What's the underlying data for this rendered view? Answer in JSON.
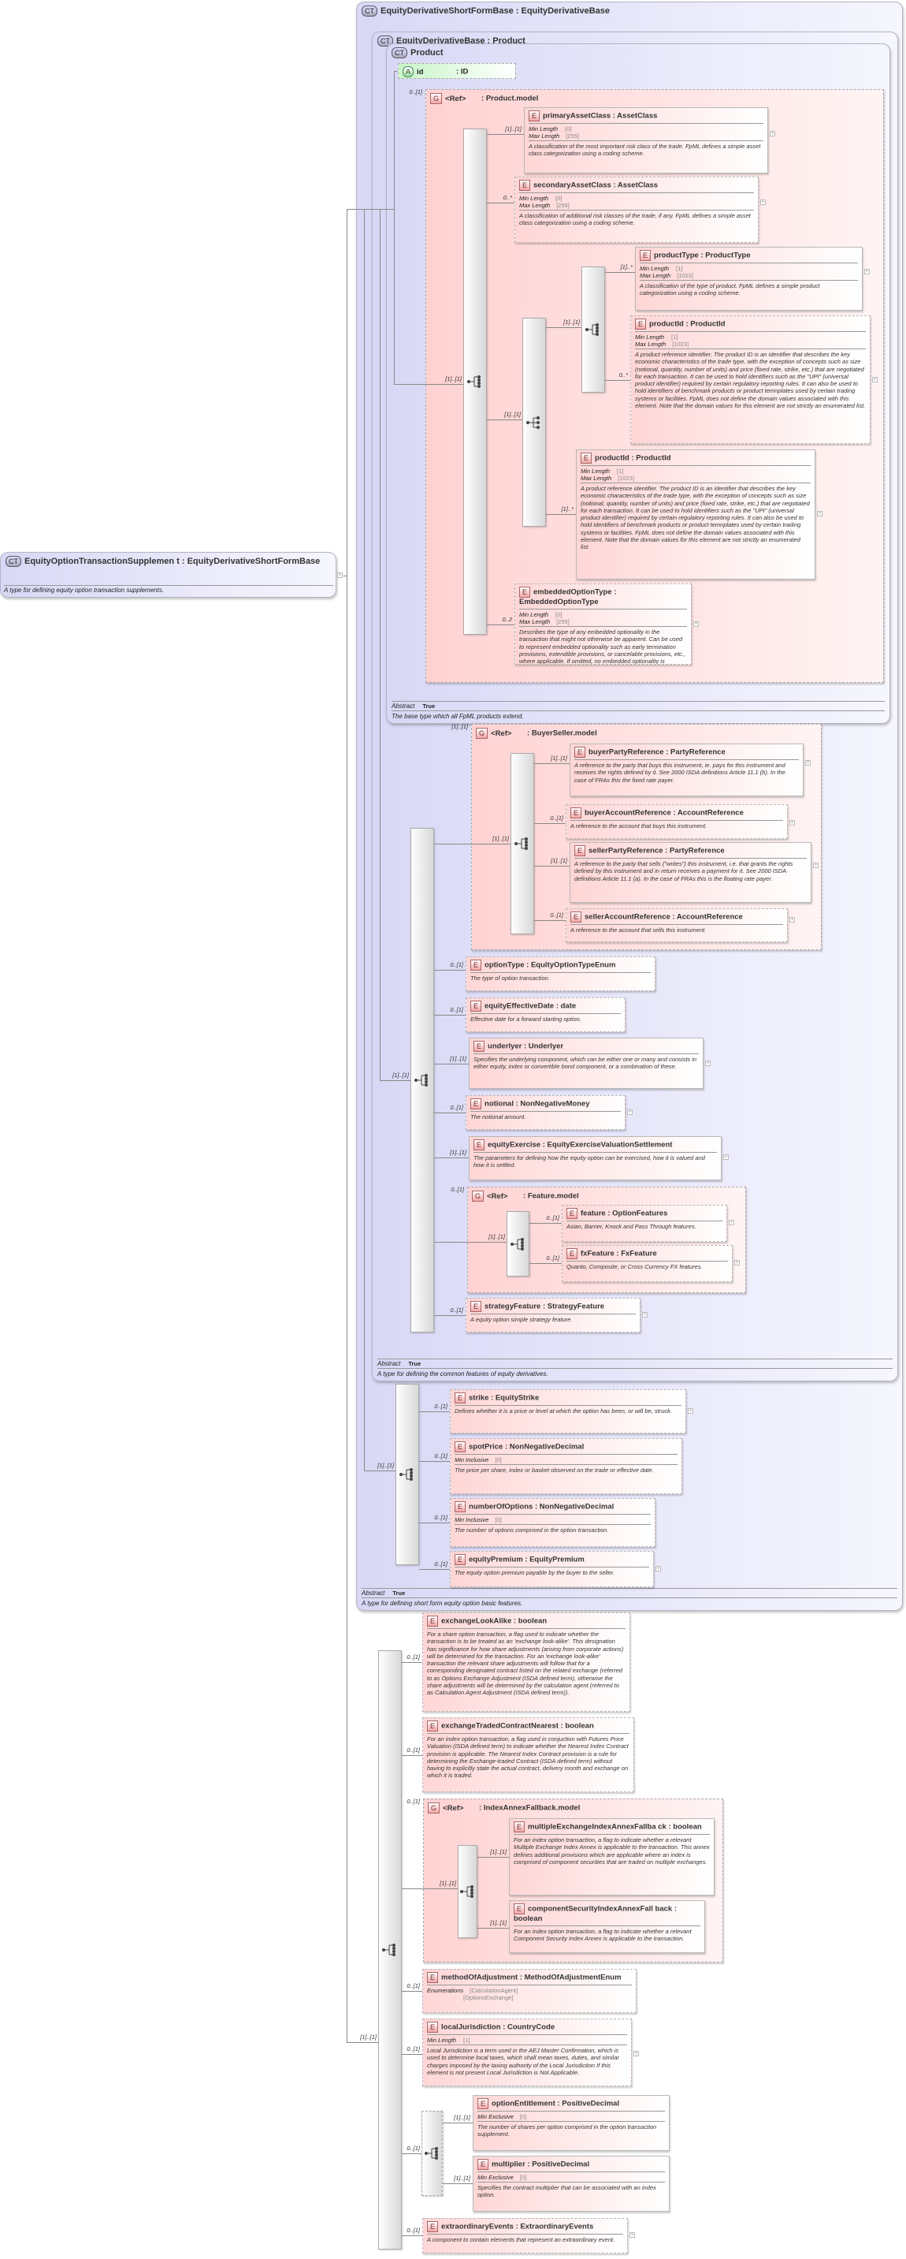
{
  "root": {
    "badge": "CT",
    "name": "EquityOptionTransactionSupplemen t",
    "base": ": EquityDerivativeShortFormBase",
    "doc": "A type for defining equity option transaction supplements."
  },
  "complex_types": {
    "shortform": {
      "badge": "CT",
      "title": "EquityDerivativeShortFormBase : EquityDerivativeBase",
      "abstract_label": "Abstract",
      "abstract_value": "True",
      "doc": "A type for defining short form equity option basic features."
    },
    "base": {
      "badge": "CT",
      "title": "EquityDerivativeBase : Product",
      "abstract_label": "Abstract",
      "abstract_value": "True",
      "doc": "A type for defining the common features of equity derivatives."
    },
    "product": {
      "badge": "CT",
      "title": "Product",
      "abstract_label": "Abstract",
      "abstract_value": "True",
      "doc": "The base type which all FpML products extend."
    }
  },
  "attribute": {
    "badge": "A",
    "name": "id",
    "type": ": ID"
  },
  "groups": {
    "product_model": {
      "badge": "G",
      "ref": "<Ref>",
      "type": ": Product.model",
      "occ": "0..[1]"
    },
    "buyer_seller": {
      "badge": "G",
      "ref": "<Ref>",
      "type": ": BuyerSeller.model",
      "occ": "[1]..[1]"
    },
    "feature_model": {
      "badge": "G",
      "ref": "<Ref>",
      "type": ": Feature.model",
      "occ": "0..[1]"
    },
    "index_annex": {
      "badge": "G",
      "ref": "<Ref>",
      "type": ": IndexAnnexFallback.model",
      "occ": "0..[1]"
    }
  },
  "connector_labels": {
    "pm_seq": "[1]..[1]",
    "choice": "[1]..[1]",
    "inner_seq": "[1]..[1]",
    "bs_seq": "[1]..[1]",
    "base_seq": "[1]..[1]",
    "sf_seq": "[1]..[1]",
    "root_seq": "[1]..[1]",
    "feat_seq": "[1]..[1]",
    "iaf_seq": "[1]..[1]",
    "opt_seq": "0..[1]"
  },
  "elements": {
    "primaryAssetClass": {
      "badge": "E",
      "name": "primaryAssetClass",
      "type": ": AssetClass",
      "occ": "[1]..[1]",
      "facets": [
        {
          "label": "Min Length",
          "value": "[0]"
        },
        {
          "label": "Max Length",
          "value": "[255]"
        }
      ],
      "doc": "A classification of the most important risk class of the trade. FpML defines a simple asset class categorization using a coding scheme."
    },
    "secondaryAssetClass": {
      "badge": "E",
      "name": "secondaryAssetClass",
      "type": ": AssetClass",
      "occ": "0..*",
      "facets": [
        {
          "label": "Min Length",
          "value": "[0]"
        },
        {
          "label": "Max Length",
          "value": "[255]"
        }
      ],
      "doc": "A classification of additional risk classes of the trade, if any. FpML defines a simple asset class categorization using a coding scheme."
    },
    "productType": {
      "badge": "E",
      "name": "productType",
      "type": ": ProductType",
      "occ": "[1]..*",
      "facets": [
        {
          "label": "Min Length",
          "value": "[1]"
        },
        {
          "label": "Max Length",
          "value": "[1023]"
        }
      ],
      "doc": "A classification of the type of product. FpML defines a simple product categorization using a coding scheme."
    },
    "productId": {
      "badge": "E",
      "name": "productId",
      "type": ": ProductId",
      "occ": "0..*",
      "facets": [
        {
          "label": "Min Length",
          "value": "[1]"
        },
        {
          "label": "Max Length",
          "value": "[1023]"
        }
      ],
      "doc": "A product reference identifier. The product ID is an identifier that describes the key economic characteristics of the trade type, with the exception of concepts such as size (notional, quantity, number of units) and price (fixed rate, strike, etc.) that are negotiated for each transaction. It can be used to hold identifiers such as the \"UPI\" (universal product identifier) required by certain regulatory reporting rules. It can also be used to hold identifiers of benchmark products or product temnplates used by certain trading systems or facilities. FpML does not define the domain values associated with this element. Note that the domain values for this element are not strictly an enumerated list."
    },
    "productId2": {
      "badge": "E",
      "name": "productId",
      "type": ": ProductId",
      "occ": "[1]..*",
      "facets": [
        {
          "label": "Min Length",
          "value": "[1]"
        },
        {
          "label": "Max Length",
          "value": "[1023]"
        }
      ],
      "doc": "A product reference identifier. The product ID is an identifier that describes the key economic characteristics of the trade type, with the exception of concepts such as size (notional, quantity, number of units) and price (fixed rate, strike, etc.) that are negotiated for each transaction. It can be used to hold identifiers such as the \"UPI\" (universal product identifier) required by certain regulatory reporting rules. It can also be used to hold identifiers of benchmark products or product temnplates used by certain trading systems or facilities. FpML does not define the domain values associated with this element. Note that the domain values for this element are not strictly an enumerated list."
    },
    "embeddedOptionType": {
      "badge": "E",
      "name": "embeddedOptionType",
      "type": ": EmbeddedOptionType",
      "occ": "0..2",
      "facets": [
        {
          "label": "Min Length",
          "value": "[0]"
        },
        {
          "label": "Max Length",
          "value": "[255]"
        }
      ],
      "doc": "Describes the type of any embedded optionality in the transaction that might not otherwise be apparent. Can be used to represent embedded optionality such as early termination provisions, extendible provisions, or cancelable provisions, etc., where applicable. If omitted, no embedded optionality is applicable."
    },
    "buyerPartyReference": {
      "badge": "E",
      "name": "buyerPartyReference",
      "type": ": PartyReference",
      "occ": "[1]..[1]",
      "facets": [],
      "doc": "A reference to the party that buys this instrument, ie. pays for this instrument and receives the rights defined by it. See 2000 ISDA definitions Article 11.1 (b). In the case of FRAs this the fixed rate payer."
    },
    "buyerAccountReference": {
      "badge": "E",
      "name": "buyerAccountReference",
      "type": ": AccountReference",
      "occ": "0..[1]",
      "facets": [],
      "doc": "A reference to the account that buys this instrument."
    },
    "sellerPartyReference": {
      "badge": "E",
      "name": "sellerPartyReference",
      "type": ": PartyReference",
      "occ": "[1]..[1]",
      "facets": [],
      "doc": "A reference to the party that sells (\"writes\") this instrument, i.e. that grants the rights defined by this instrument and in return receives a payment for it. See 2000 ISDA definitions Article 11.1 (a). In the case of FRAs this is the floating rate payer."
    },
    "sellerAccountReference": {
      "badge": "E",
      "name": "sellerAccountReference",
      "type": ": AccountReference",
      "occ": "0..[1]",
      "facets": [],
      "doc": "A reference to the account that sells this instrument."
    },
    "optionType": {
      "badge": "E",
      "name": "optionType",
      "type": ": EquityOptionTypeEnum",
      "occ": "0..[1]",
      "facets": [],
      "doc": "The type of option transaction."
    },
    "equityEffectiveDate": {
      "badge": "E",
      "name": "equityEffectiveDate",
      "type": ": date",
      "occ": "0..[1]",
      "facets": [],
      "doc": "Effective date for a forward starting option."
    },
    "underlyer": {
      "badge": "E",
      "name": "underlyer",
      "type": ": Underlyer",
      "occ": "[1]..[1]",
      "facets": [],
      "doc": "Specifies the underlying component, which can be either one or many and consists in either equity, index or convertible bond component, or a combination of these."
    },
    "notional": {
      "badge": "E",
      "name": "notional",
      "type": ": NonNegativeMoney",
      "occ": "0..[1]",
      "facets": [],
      "doc": "The notional amount."
    },
    "equityExercise": {
      "badge": "E",
      "name": "equityExercise",
      "type": ": EquityExerciseValuationSettlement",
      "occ": "[1]..[1]",
      "facets": [],
      "doc": "The parameters for defining how the equity option can be exercised, how it is valued and how it is settled."
    },
    "feature": {
      "badge": "E",
      "name": "feature",
      "type": ": OptionFeatures",
      "occ": "0..[1]",
      "facets": [],
      "doc": "Asian, Barrier, Knock and Pass Through features."
    },
    "fxFeature": {
      "badge": "E",
      "name": "fxFeature",
      "type": ": FxFeature",
      "occ": "0..[1]",
      "facets": [],
      "doc": "Quanto, Composite, or Cross Currency FX features."
    },
    "strategyFeature": {
      "badge": "E",
      "name": "strategyFeature",
      "type": ": StrategyFeature",
      "occ": "0..[1]",
      "facets": [],
      "doc": "A equity option simple strategy feature."
    },
    "strike": {
      "badge": "E",
      "name": "strike",
      "type": ": EquityStrike",
      "occ": "0..[1]",
      "facets": [],
      "doc": "Defines whether it is a price or level at which the option has been, or will be, struck."
    },
    "spotPrice": {
      "badge": "E",
      "name": "spotPrice",
      "type": ": NonNegativeDecimal",
      "occ": "0..[1]",
      "facets": [
        {
          "label": "Min Inclusive",
          "value": "[0]"
        }
      ],
      "doc": "The price per share, index or basket observed on the trade or effective date."
    },
    "numberOfOptions": {
      "badge": "E",
      "name": "numberOfOptions",
      "type": ": NonNegativeDecimal",
      "occ": "0..[1]",
      "facets": [
        {
          "label": "Min Inclusive",
          "value": "[0]"
        }
      ],
      "doc": "The number of options comprised in the option transaction."
    },
    "equityPremium": {
      "badge": "E",
      "name": "equityPremium",
      "type": ": EquityPremium",
      "occ": "0..[1]",
      "facets": [],
      "doc": "The equity option premium payable by the buyer to the seller."
    },
    "exchangeLookAlike": {
      "badge": "E",
      "name": "exchangeLookAlike",
      "type": ": boolean",
      "occ": "0..[1]",
      "facets": [],
      "doc": "For a share option transaction, a flag used to indicate whether the transaction is to be treated as an 'exchange look-alike'. This designation has significance for how share adjustments (arising from corporate actions) will be determined for the transaction. For an 'exchange look-alike' transaction the relevant share adjustments will follow that for a corresponding designated contract listed on the related exchange (referred to as Options Exchange Adjustment (ISDA defined term), otherwise the share adjustments will be determined by the calculation agent (referred to as Calculation Agent Adjustment (ISDA defined term))."
    },
    "exchangeTradedContractNearest": {
      "badge": "E",
      "name": "exchangeTradedContractNearest",
      "type": ": boolean",
      "occ": "0..[1]",
      "facets": [],
      "doc": "For an index option transaction, a flag used in conjuction with Futures Price Valuation (ISDA defined term) to indicate whether the Nearest Index Contract provision is applicable. The Nearest Index Contract provision is a rule for determining the Exchange-traded Contract (ISDA defined term) without having to explicitly state the actual contract, delivery month and exchange on which it is traded."
    },
    "multipleExchangeIndexAnnexFallback": {
      "badge": "E",
      "name": "multipleExchangeIndexAnnexFallba ck",
      "type": ": boolean",
      "occ": "[1]..[1]",
      "facets": [],
      "doc": "For an index option transaction, a flag to indicate whether a relevant Multiple Exchange Index Annex is applicable to the transaction. This annex defines additional provisions which are applicable where an index is comprised of component securities that are traded on multiple exchanges."
    },
    "componentSecurityIndexAnnexFallback": {
      "badge": "E",
      "name": "componentSecurityIndexAnnexFall back",
      "type": ": boolean",
      "occ": "[1]..[1]",
      "facets": [],
      "doc": "For an index option transaction, a flag to indicate whether a relevant Component Security Index Annex is applicable to the transaction."
    },
    "methodOfAdjustment": {
      "badge": "E",
      "name": "methodOfAdjustment",
      "type": ": MethodOfAdjustmentEnum",
      "occ": "0..[1]",
      "facets": [
        {
          "label": "Enumerations",
          "value": "[CalculationAgent]"
        },
        {
          "label": "",
          "value": "[OptionsExchange]"
        }
      ],
      "doc": ""
    },
    "localJurisdiction": {
      "badge": "E",
      "name": "localJurisdiction",
      "type": ": CountryCode",
      "occ": "0..[1]",
      "facets": [
        {
          "label": "Min Length",
          "value": "[1]"
        }
      ],
      "doc": "Local Jurisdiction is a term used in the AEJ Master Confirmation, which is used to determine local taxes, which shall mean taxes, duties, and similar charges imposed by the taxing authority of the Local Jurisdiction If this element is not present Local Jurisdiction is Not Applicable."
    },
    "optionEntitlement": {
      "badge": "E",
      "name": "optionEntitlement",
      "type": ": PositiveDecimal",
      "occ": "[1]..[1]",
      "facets": [
        {
          "label": "Min Exclusive",
          "value": "[0]"
        }
      ],
      "doc": "The number of shares per option comprised in the option transaction supplement."
    },
    "multiplier": {
      "badge": "E",
      "name": "multiplier",
      "type": ": PositiveDecimal",
      "occ": "[1]..[1]",
      "facets": [
        {
          "label": "Min Exclusive",
          "value": "[0]"
        }
      ],
      "doc": "Specifies the contract multiplier that can be associated with an index option."
    },
    "extraordinaryEvents": {
      "badge": "E",
      "name": "extraordinaryEvents",
      "type": ": ExtraordinaryEvents",
      "occ": "0..[1]",
      "facets": [],
      "doc": "A component to contain elements that represent an extraordinary event."
    }
  },
  "colors": {
    "ct_bg": "#d8d8f6",
    "element_bg": "#ffd6d6",
    "attribute_bg": "#c8f5c8",
    "line": "#888888"
  }
}
